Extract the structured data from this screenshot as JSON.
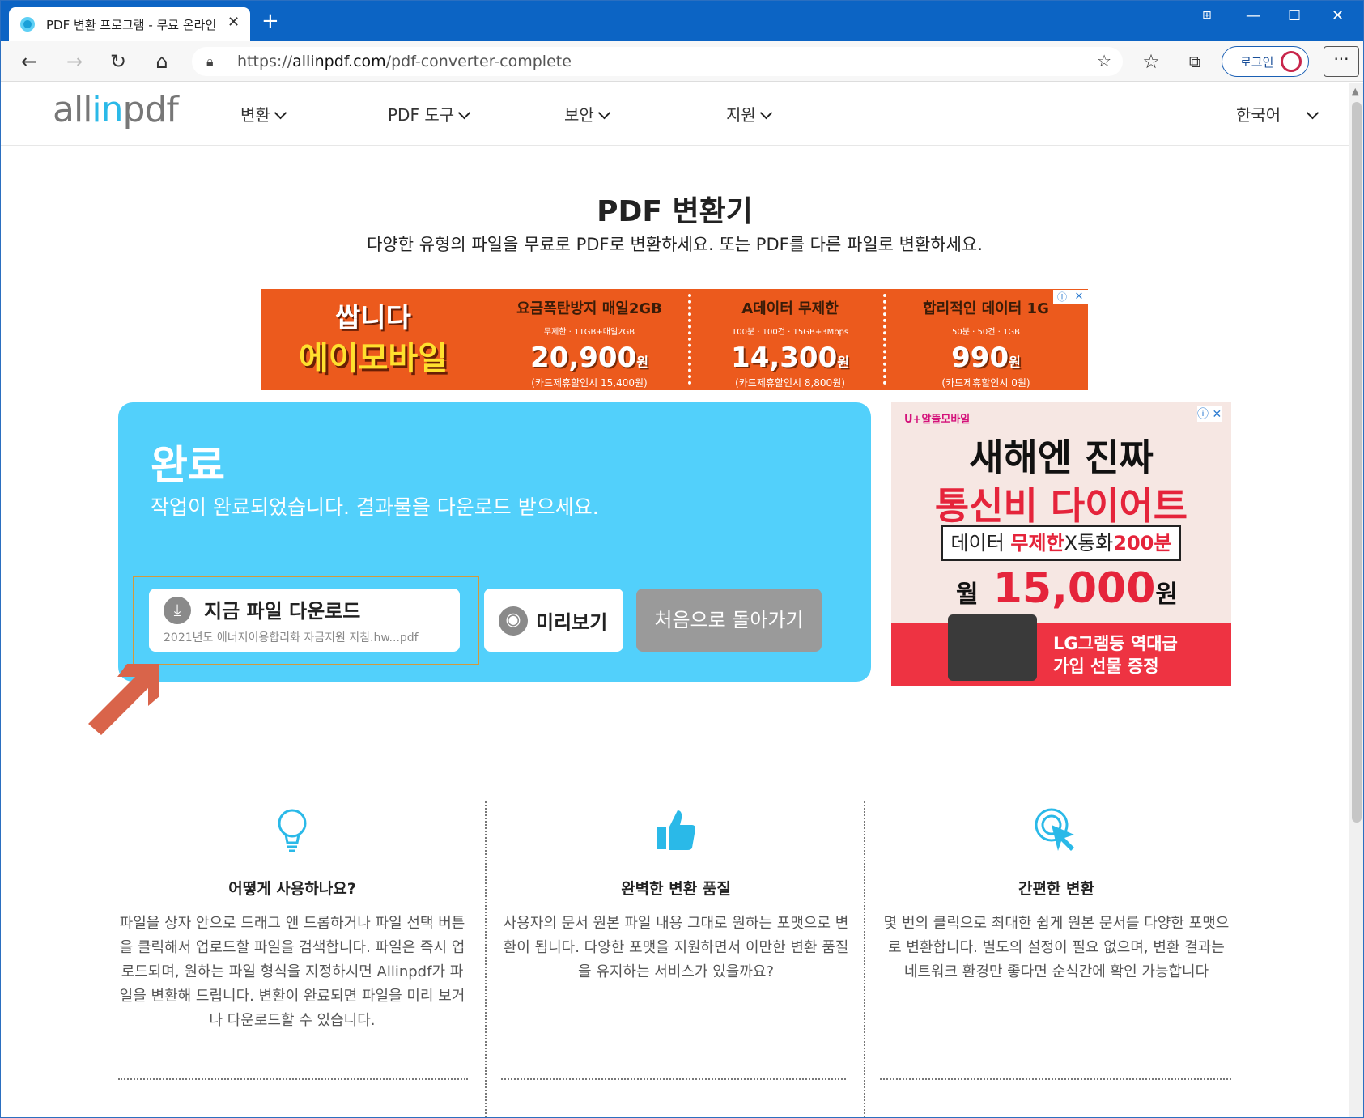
{
  "browser": {
    "tab_title": "PDF 변환 프로그램 - 무료 온라인",
    "url_prefix": "https://",
    "url_domain": "allinpdf.com",
    "url_path": "/pdf-converter-complete",
    "login_label": "로그인"
  },
  "site": {
    "logo_prefix": "all",
    "logo_highlight": "in",
    "logo_suffix": "pdf",
    "menu": [
      {
        "label": "변환"
      },
      {
        "label": "PDF 도구"
      },
      {
        "label": "보안"
      },
      {
        "label": "지원"
      }
    ],
    "language": "한국어"
  },
  "hero": {
    "title": "PDF 변환기",
    "subtitle": "다양한 유형의 파일을 무료로 PDF로 변환하세요. 또는 PDF를 다른 파일로 변환하세요."
  },
  "banner_ad": {
    "logo_line1": "쌉니다",
    "logo_line2": "에이모바일",
    "plans": [
      {
        "title": "요금폭탄방지 매일2GB",
        "features": "무제한 · 11GB+매일2GB",
        "price": "20,900",
        "unit": "원",
        "note": "(카드제휴할인시 15,400원)"
      },
      {
        "title": "A데이터 무제한",
        "features": "100분 · 100건 · 15GB+3Mbps",
        "price": "14,300",
        "unit": "원",
        "note": "(카드제휴할인시 8,800원)"
      },
      {
        "title": "합리적인 데이터 1G",
        "features": "50분 · 50건 · 1GB",
        "price": "990",
        "unit": "원",
        "note": "(카드제휴할인시 0원)"
      }
    ]
  },
  "result": {
    "title": "완료",
    "description": "작업이 완료되었습니다. 결과물을 다운로드 받으세요.",
    "download_label": "지금 파일 다운로드",
    "file_name": "2021년도 에너지이용합리화 자금지원 지침.hw...pdf",
    "preview_label": "미리보기",
    "restart_label": "처음으로 돌아가기"
  },
  "side_ad": {
    "brand": "U+알뜰모바일",
    "line1": "새해엔 진짜",
    "line2": "통신비 다이어트",
    "box_part1": "데이터 ",
    "box_red1": "무제한",
    "box_part2": "X통화",
    "box_red2": "200분",
    "price_prefix": "월",
    "price": "15,000",
    "price_suffix": "원",
    "promo_line1": "LG그램등 역대급",
    "promo_line2": "가입 선물 증정"
  },
  "features": [
    {
      "icon": "lightbulb-icon",
      "title": "어떻게 사용하나요?",
      "text": "파일을 상자 안으로 드래그 앤 드롭하거나 파일 선택 버튼을 클릭해서 업로드할 파일을 검색합니다. 파일은 즉시 업로드되며, 원하는 파일 형식을 지정하시면 Allinpdf가 파일을 변환해 드립니다. 변환이 완료되면 파일을 미리 보거나 다운로드할 수 있습니다."
    },
    {
      "icon": "thumbs-up-icon",
      "title": "완벽한 변환 품질",
      "text": "사용자의 문서 원본 파일 내용 그대로 원하는 포맷으로 변환이 됩니다. 다양한 포맷을 지원하면서 이만한 변환 품질을 유지하는 서비스가 있을까요?"
    },
    {
      "icon": "click-icon",
      "title": "간편한 변환",
      "text": "몇 번의 클릭으로 최대한 쉽게 원본 문서를 다양한 포맷으로 변환합니다. 별도의 설정이 필요 없으며, 변환 결과는 네트워크 환경만 좋다면 순식간에 확인 가능합니다"
    }
  ],
  "colors": {
    "accent": "#52d0fb",
    "titlebar": "#0c64c4",
    "highlight_frame": "#d39a3c",
    "arrow": "#d9644a"
  }
}
